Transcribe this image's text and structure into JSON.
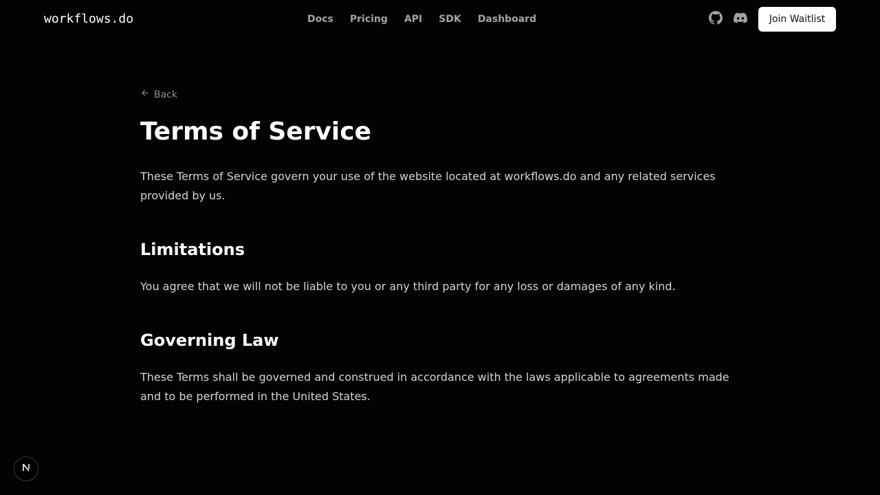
{
  "header": {
    "logo": "workflows.do",
    "nav": [
      "Docs",
      "Pricing",
      "API",
      "SDK",
      "Dashboard"
    ],
    "icons": [
      "github-icon",
      "discord-icon"
    ],
    "cta_label": "Join Waitlist"
  },
  "main": {
    "back_label": "Back",
    "title": "Terms of Service",
    "intro": "These Terms of Service govern your use of the website located at workflows.do and any related services provided by us.",
    "sections": [
      {
        "heading": "Limitations",
        "body": "You agree that we will not be liable to you or any third party for any loss or damages of any kind."
      },
      {
        "heading": "Governing Law",
        "body": "These Terms shall be governed and construed in accordance with the laws applicable to agreements made and to be performed in the United States."
      }
    ]
  },
  "footer": {
    "badge_icon": "nextjs-logo-icon"
  },
  "colors": {
    "background": "#030303",
    "text": "#ffffff",
    "muted": "#a3a3a3",
    "body_text": "#d4d4d4",
    "button_bg": "#ffffff"
  }
}
